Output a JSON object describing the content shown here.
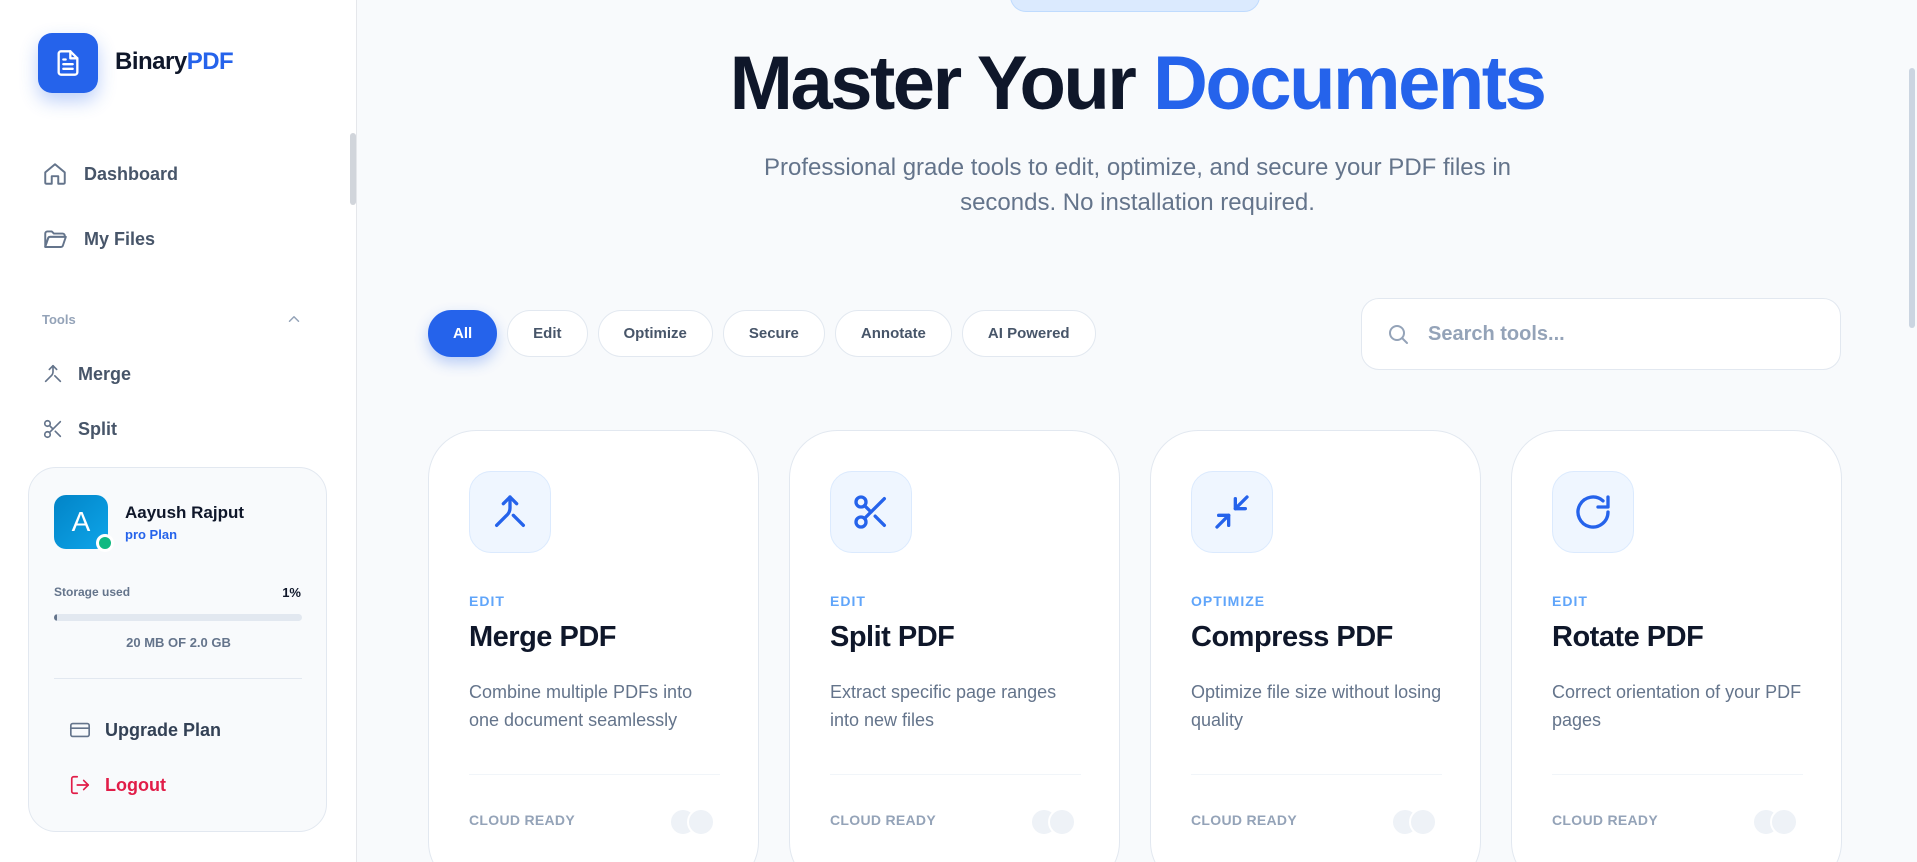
{
  "brand": {
    "name": "Binary",
    "accent": "PDF"
  },
  "nav": [
    {
      "label": "Dashboard",
      "icon": "home-icon"
    },
    {
      "label": "My Files",
      "icon": "folder-icon"
    }
  ],
  "tools_section": {
    "label": "Tools",
    "items": [
      {
        "label": "Merge",
        "icon": "merge-icon"
      },
      {
        "label": "Split",
        "icon": "scissors-icon"
      }
    ]
  },
  "user": {
    "initial": "A",
    "name": "Aayush Rajput",
    "plan": "pro Plan",
    "storage_label": "Storage used",
    "storage_percent": "1%",
    "storage_fraction": 0.01,
    "storage_detail": "20 MB OF 2.0 GB",
    "upgrade_label": "Upgrade Plan",
    "logout_label": "Logout"
  },
  "hero": {
    "title_main": "Master Your",
    "title_accent": "Documents",
    "subtitle": "Professional grade tools to edit, optimize, and secure your PDF files in seconds. No installation required."
  },
  "filters": [
    "All",
    "Edit",
    "Optimize",
    "Secure",
    "Annotate",
    "AI Powered"
  ],
  "active_filter": "All",
  "search": {
    "placeholder": "Search tools..."
  },
  "cards": [
    {
      "category": "EDIT",
      "title": "Merge PDF",
      "description": "Combine multiple PDFs into one document seamlessly",
      "footer": "CLOUD READY",
      "icon": "merge-icon"
    },
    {
      "category": "EDIT",
      "title": "Split PDF",
      "description": "Extract specific page ranges into new files",
      "footer": "CLOUD READY",
      "icon": "scissors-icon"
    },
    {
      "category": "OPTIMIZE",
      "title": "Compress PDF",
      "description": "Optimize file size without losing quality",
      "footer": "CLOUD READY",
      "icon": "compress-icon"
    },
    {
      "category": "EDIT",
      "title": "Rotate PDF",
      "description": "Correct orientation of your PDF pages",
      "footer": "CLOUD READY",
      "icon": "rotate-icon"
    }
  ],
  "colors": {
    "accent": "#2563eb",
    "logout": "#e11d48",
    "online": "#10b981"
  }
}
